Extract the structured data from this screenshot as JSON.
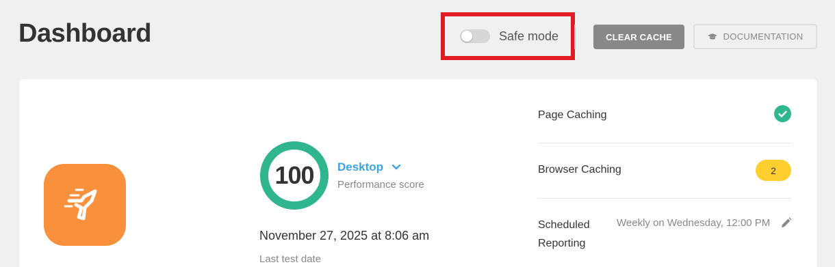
{
  "header": {
    "title": "Dashboard",
    "safe_mode_label": "Safe mode",
    "safe_mode_on": false,
    "clear_cache_label": "CLEAR CACHE",
    "documentation_label": "DOCUMENTATION"
  },
  "summary": {
    "score": "100",
    "score_fraction": 1.0,
    "device": "Desktop",
    "score_label": "Performance score",
    "test_date": "November 27, 2025 at 8:06 am",
    "test_date_label": "Last test date"
  },
  "status_list": {
    "page_caching": {
      "label": "Page Caching",
      "status": "check-icon"
    },
    "browser_caching": {
      "label": "Browser Caching",
      "issues": "2"
    },
    "scheduled_reporting": {
      "label": "Scheduled Reporting",
      "value": "Weekly on Wednesday, 12:00 PM"
    }
  },
  "colors": {
    "accent_blue": "#3ca5e0",
    "success_green": "#2fb68e",
    "warning_yellow": "#fecf2f",
    "brand_orange": "#f8903c",
    "highlight_red": "#e01b24"
  }
}
